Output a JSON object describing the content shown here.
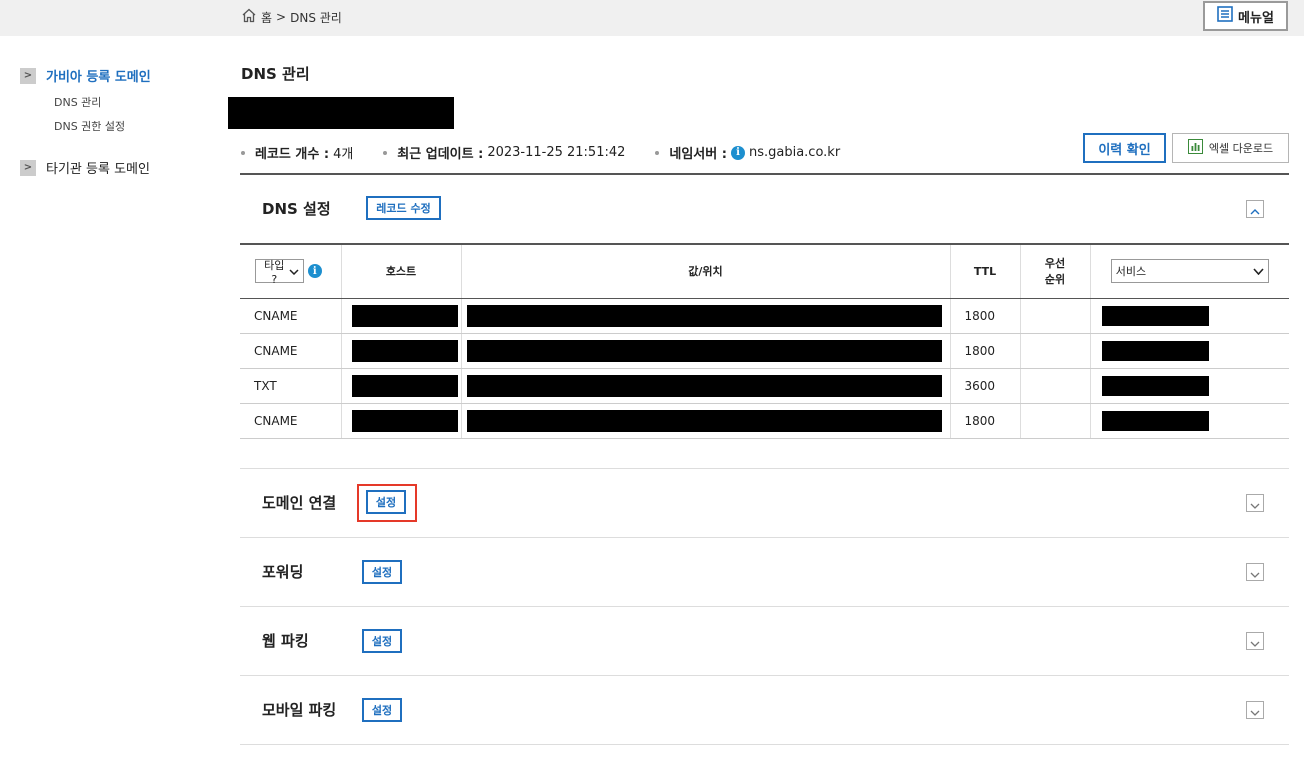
{
  "breadcrumb": {
    "home": "홈",
    "separator": ">",
    "current": "DNS 관리"
  },
  "menu_button": "메뉴얼",
  "sidebar": {
    "sections": [
      {
        "label": "가비아 등록 도메인",
        "active": true,
        "items": [
          "DNS 관리",
          "DNS 권한 설정"
        ]
      },
      {
        "label": "타기관 등록 도메인",
        "active": false,
        "items": []
      }
    ]
  },
  "page_title": "DNS 관리",
  "info": {
    "record_count_label": "레코드 개수 :",
    "record_count_value": "4개",
    "last_update_label": "최근 업데이트 :",
    "last_update_value": "2023-11-25 21:51:42",
    "nameserver_label": "네임서버 :",
    "nameserver_value": "ns.gabia.co.kr"
  },
  "buttons": {
    "history": "이력 확인",
    "excel": "엑셀 다운로드"
  },
  "dns_section": {
    "title": "DNS 설정",
    "edit_button": "레코드 수정",
    "columns": {
      "type_select": "타입 ?",
      "host": "호스트",
      "value": "값/위치",
      "ttl": "TTL",
      "priority_line1": "우선",
      "priority_line2": "순위",
      "service_select": "서비스"
    },
    "rows": [
      {
        "type": "CNAME",
        "ttl": "1800"
      },
      {
        "type": "CNAME",
        "ttl": "1800"
      },
      {
        "type": "TXT",
        "ttl": "3600"
      },
      {
        "type": "CNAME",
        "ttl": "1800"
      }
    ]
  },
  "sections": [
    {
      "title": "도메인 연결",
      "button": "설정"
    },
    {
      "title": "포워딩",
      "button": "설정"
    },
    {
      "title": "웹 파킹",
      "button": "설정"
    },
    {
      "title": "모바일 파킹",
      "button": "설정"
    }
  ],
  "colors": {
    "accent": "#1f6fbf",
    "highlight": "#e53929",
    "info_icon": "#1d8fcf"
  }
}
